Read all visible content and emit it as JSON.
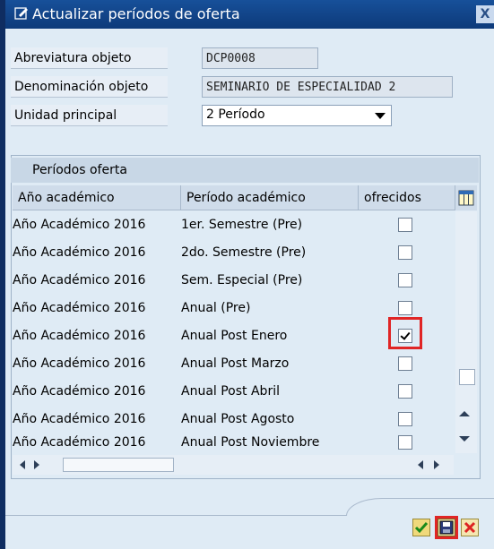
{
  "window": {
    "title": "Actualizar períodos de oferta",
    "close_label": "X"
  },
  "form": {
    "abbr_label": "Abreviatura objeto",
    "abbr_value": "DCP0008",
    "name_label": "Denominación objeto",
    "name_value": "SEMINARIO DE ESPECIALIDAD 2",
    "unit_label": "Unidad principal",
    "unit_value": "2 Período"
  },
  "table": {
    "group_title": "Períodos oferta",
    "columns": [
      "Año académico",
      "Período académico",
      "ofrecidos"
    ],
    "rows": [
      {
        "year": "Año Académico 2016",
        "period": "1er. Semestre (Pre)",
        "offered": false
      },
      {
        "year": "Año Académico 2016",
        "period": "2do. Semestre (Pre)",
        "offered": false
      },
      {
        "year": "Año Académico 2016",
        "period": "Sem. Especial (Pre)",
        "offered": false
      },
      {
        "year": "Año Académico 2016",
        "period": "Anual (Pre)",
        "offered": false
      },
      {
        "year": "Año Académico 2016",
        "period": "Anual Post Enero",
        "offered": true
      },
      {
        "year": "Año Académico 2016",
        "period": "Anual Post Marzo",
        "offered": false
      },
      {
        "year": "Año Académico 2016",
        "period": "Anual Post Abril",
        "offered": false
      },
      {
        "year": "Año Académico 2016",
        "period": "Anual Post Agosto",
        "offered": false
      },
      {
        "year": "Año Académico 2016",
        "period": "Anual Post Noviembre",
        "offered": false
      }
    ]
  },
  "footer": {
    "buttons": [
      "check-icon",
      "save-icon",
      "cancel-icon"
    ]
  },
  "colors": {
    "title_bar": "#17509a",
    "highlight": "#e02525",
    "window_bg": "#dfebf5"
  }
}
